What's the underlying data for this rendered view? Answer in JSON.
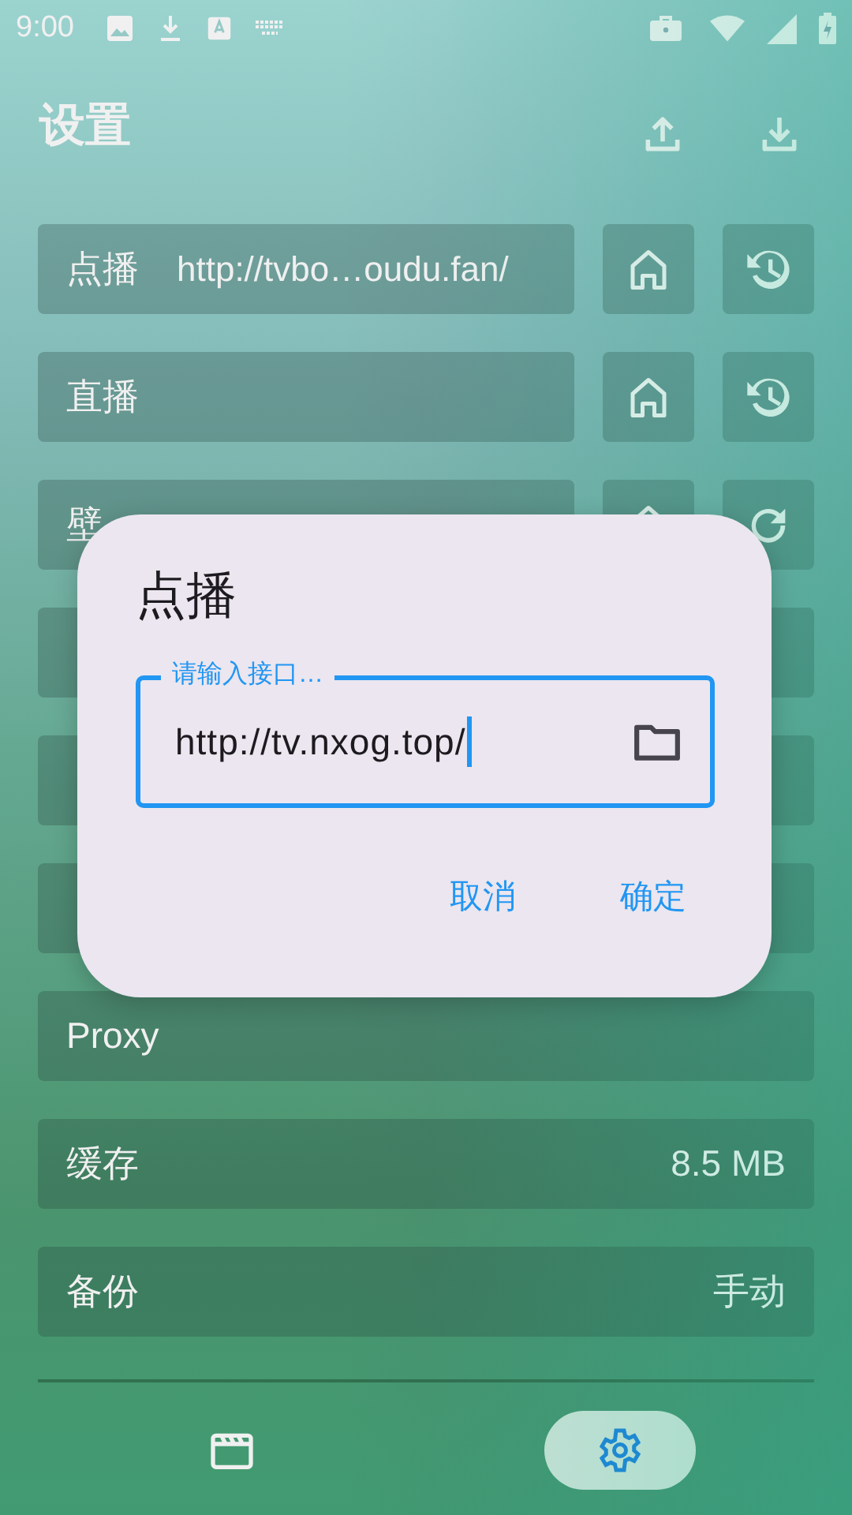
{
  "status_bar": {
    "time": "9:00"
  },
  "header": {
    "title": "设置"
  },
  "settings": [
    {
      "kind": "source",
      "label": "点播",
      "value": "http://tvbo…oudu.fan/"
    },
    {
      "kind": "source",
      "label": "直播"
    },
    {
      "kind": "wallpaper",
      "label": "壁"
    },
    {
      "kind": "plain"
    },
    {
      "kind": "plain"
    },
    {
      "kind": "plain"
    },
    {
      "kind": "plain",
      "label": "Proxy"
    },
    {
      "kind": "plain",
      "label": "缓存",
      "value": "8.5 MB"
    },
    {
      "kind": "plain",
      "label": "备份",
      "value": "手动"
    }
  ],
  "nav": [
    {
      "selected": false
    },
    {
      "selected": true
    }
  ],
  "dialog": {
    "title": "点播",
    "field": {
      "label": "请输入接口…",
      "value": "http://tv.nxog.top/",
      "focused": true
    },
    "buttons": [
      "取消",
      "确定"
    ]
  }
}
